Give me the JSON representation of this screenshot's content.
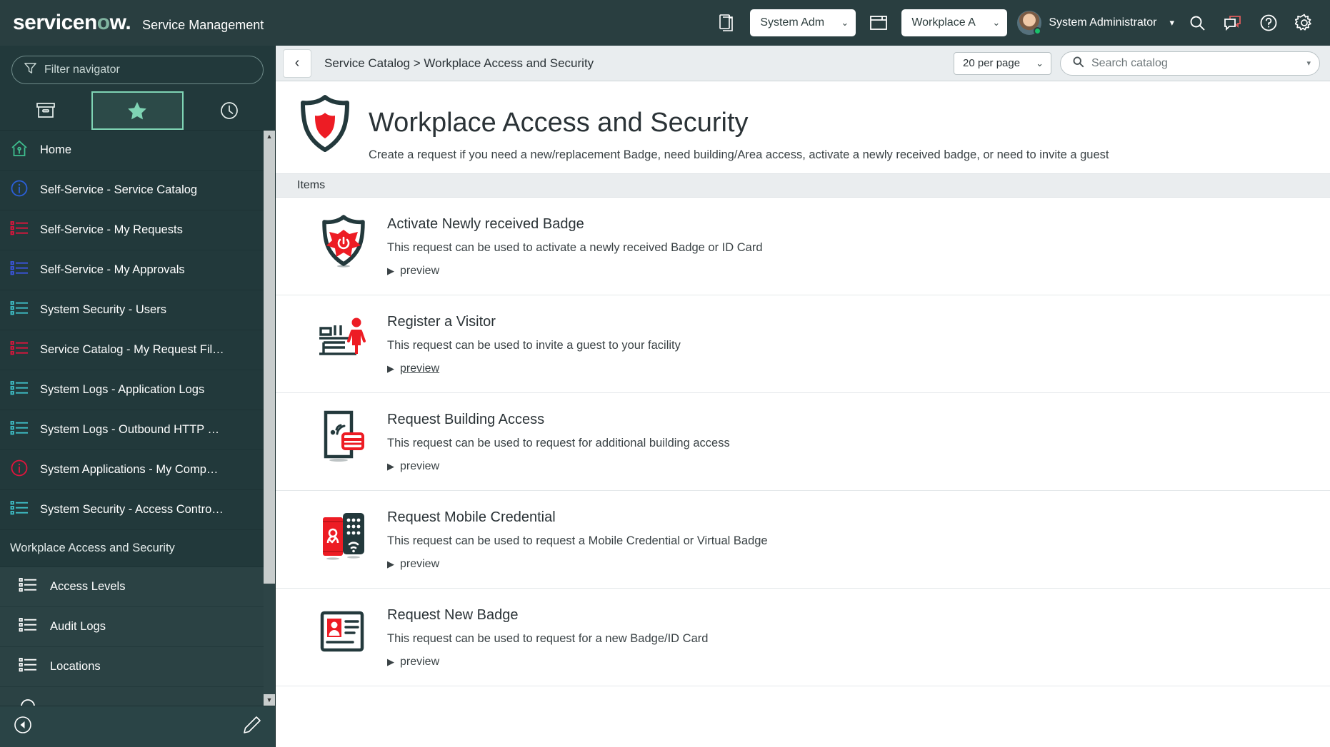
{
  "banner": {
    "logo_text": "servicenow",
    "logo_dot": ".",
    "product": "Service Management",
    "copy_icon": "copy-pages-icon",
    "app_selector": {
      "label": "System Adm",
      "caret": "⌄"
    },
    "window_icon": "window-icon",
    "scope_selector": {
      "label": "Workplace A",
      "caret": "⌄"
    },
    "user": "System Administrator",
    "user_caret": "▾",
    "icons": {
      "search": "search-icon",
      "chat": "conversation-icon",
      "help": "help-icon",
      "gear": "gear-icon"
    }
  },
  "sidebar": {
    "filter_placeholder": "Filter navigator",
    "tabs": [
      {
        "name": "all-applications",
        "icon": "archive-box-icon",
        "active": false
      },
      {
        "name": "favorites",
        "icon": "star-icon",
        "active": true
      },
      {
        "name": "history",
        "icon": "clock-icon",
        "active": false
      }
    ],
    "items": [
      {
        "label": "Home",
        "icon": "home-icon",
        "color": "#3fbf8f"
      },
      {
        "label": "Self-Service - Service Catalog",
        "icon": "info-icon",
        "color": "#2b5fd9"
      },
      {
        "label": "Self-Service - My Requests",
        "icon": "list-icon",
        "color": "#e0143c"
      },
      {
        "label": "Self-Service - My Approvals",
        "icon": "list-icon",
        "color": "#3b55e0"
      },
      {
        "label": "System Security - Users",
        "icon": "list-icon",
        "color": "#3fc0c8"
      },
      {
        "label": "Service Catalog - My Request Fil…",
        "icon": "list-icon",
        "color": "#e0143c"
      },
      {
        "label": "System Logs - Application Logs",
        "icon": "list-icon",
        "color": "#3fc0c8"
      },
      {
        "label": "System Logs - Outbound HTTP …",
        "icon": "list-icon",
        "color": "#3fc0c8"
      },
      {
        "label": "System Applications - My Comp…",
        "icon": "info-icon",
        "color": "#e0143c"
      },
      {
        "label": "System Security - Access Contro…",
        "icon": "list-icon",
        "color": "#3fc0c8"
      }
    ],
    "section_title": "Workplace Access and Security",
    "sub_items": [
      {
        "label": "Access Levels",
        "icon": "list-icon",
        "color": "#ffffff"
      },
      {
        "label": "Audit Logs",
        "icon": "list-icon",
        "color": "#ffffff"
      },
      {
        "label": "Locations",
        "icon": "list-icon",
        "color": "#ffffff"
      }
    ],
    "footer": {
      "collapse_icon": "collapse-left-icon",
      "edit_icon": "pencil-icon"
    },
    "scrollbar": {
      "up": "▲",
      "down": "▼"
    }
  },
  "toolbar": {
    "back_icon": "chevron-left-icon",
    "breadcrumb": "Service Catalog > Workplace Access and Security",
    "per_page": {
      "label": "20 per page",
      "caret": "⌄"
    },
    "search_placeholder": "Search catalog",
    "search_caret": "▾",
    "search_icon": "search-icon"
  },
  "page": {
    "icon": "shield-icon",
    "title": "Workplace Access and Security",
    "description": "Create a request if you need a new/replacement Badge, need building/Area access, activate a newly received badge, or need to invite a guest",
    "items_header": "Items",
    "preview_label": "preview",
    "items": [
      {
        "name": "Activate Newly received Badge",
        "description": "This request can be used to activate a newly received Badge or ID Card",
        "icon": "shield-power-badge-icon",
        "preview_underlined": false
      },
      {
        "name": "Register a Visitor",
        "description": "This request can be used to invite a guest to your facility",
        "icon": "reception-desk-visitor-icon",
        "preview_underlined": true
      },
      {
        "name": "Request Building Access",
        "description": "This request can be used to request for additional building access",
        "icon": "door-reader-card-icon",
        "preview_underlined": false
      },
      {
        "name": "Request Mobile Credential",
        "description": "This request can be used to request a Mobile Credential or Virtual Badge",
        "icon": "phone-keypad-icon",
        "preview_underlined": false
      },
      {
        "name": "Request New Badge",
        "description": "This request can be used to request for a new Badge/ID Card",
        "icon": "id-card-icon",
        "preview_underlined": false
      }
    ]
  },
  "colors": {
    "banner_bg": "#293e40",
    "sidebar_bg": "#22393b",
    "accent_green": "#7fd4b4",
    "accent_red": "#ed1c24",
    "dark_teal": "#23393c"
  }
}
